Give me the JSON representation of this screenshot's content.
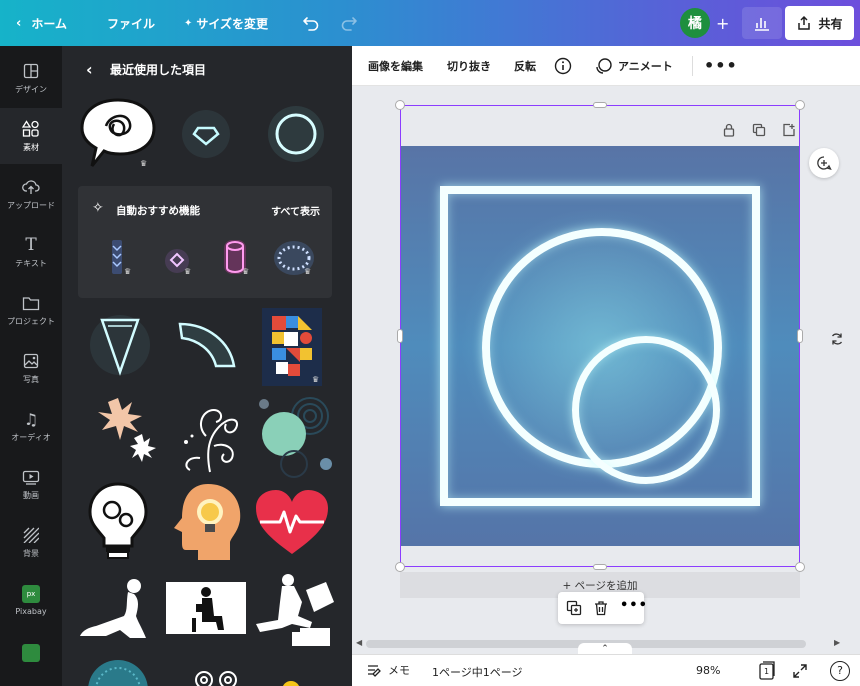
{
  "topbar": {
    "home": "ホーム",
    "file": "ファイル",
    "resize": "サイズを変更",
    "avatar_initial": "橘",
    "share": "共有"
  },
  "rail": {
    "items": [
      {
        "label": "デザイン",
        "icon": "layout-icon"
      },
      {
        "label": "素材",
        "icon": "elements-icon"
      },
      {
        "label": "アップロード",
        "icon": "upload-icon"
      },
      {
        "label": "テキスト",
        "icon": "text-icon"
      },
      {
        "label": "プロジェクト",
        "icon": "folder-icon"
      },
      {
        "label": "写真",
        "icon": "photo-icon"
      },
      {
        "label": "オーディオ",
        "icon": "audio-icon"
      },
      {
        "label": "動画",
        "icon": "video-icon"
      },
      {
        "label": "背景",
        "icon": "background-icon"
      },
      {
        "label": "Pixabay",
        "icon": "pixabay-icon"
      }
    ]
  },
  "panel": {
    "title": "最近使用した項目",
    "recommend_title": "自動おすすめ機能",
    "see_all": "すべて表示"
  },
  "context_toolbar": {
    "edit_image": "画像を編集",
    "crop": "切り抜き",
    "flip": "反転",
    "animate": "アニメート"
  },
  "canvas": {
    "add_page": "+ ページを追加"
  },
  "bottombar": {
    "notes": "メモ",
    "page_info": "1ページ中1ページ",
    "zoom": "98%",
    "page_count": "1"
  },
  "colors": {
    "accent": "#7d2ae8",
    "selection": "#8b3dff",
    "neon": "#7fe6f0",
    "heart": "#e8304a"
  }
}
